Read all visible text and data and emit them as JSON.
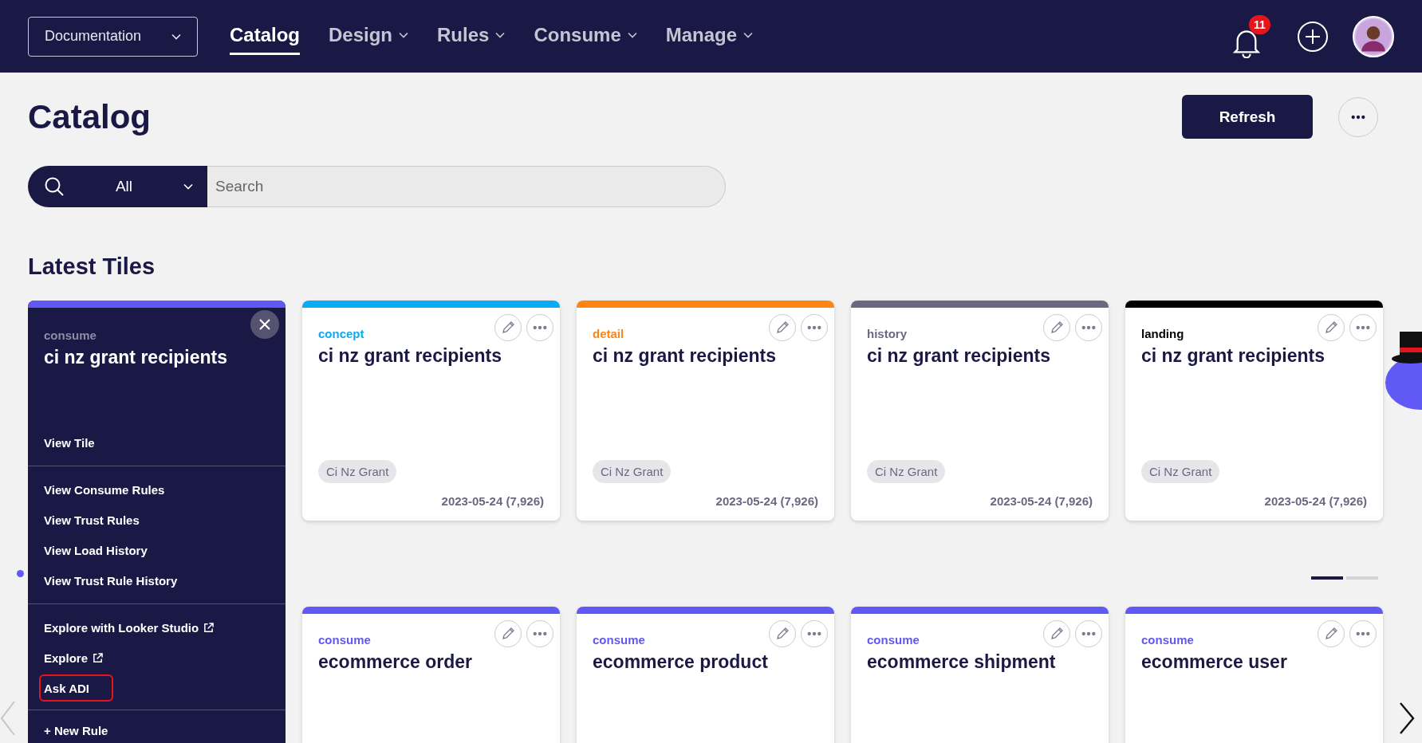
{
  "topbar": {
    "space_selector": "Documentation",
    "nav": [
      {
        "label": "Catalog",
        "selected": true,
        "has_menu": false
      },
      {
        "label": "Design",
        "selected": false,
        "has_menu": true
      },
      {
        "label": "Rules",
        "selected": false,
        "has_menu": true
      },
      {
        "label": "Consume",
        "selected": false,
        "has_menu": true
      },
      {
        "label": "Manage",
        "selected": false,
        "has_menu": true
      }
    ],
    "notification_count": "11"
  },
  "page": {
    "title": "Catalog",
    "refresh_button": "Refresh"
  },
  "search": {
    "scope": "All",
    "placeholder": "Search"
  },
  "section_title": "Latest Tiles",
  "tile_menu": {
    "category": "consume",
    "color": "#6159f5",
    "title": "ci nz grant recipients",
    "sections": [
      [
        {
          "label": "View Tile",
          "external": false,
          "highlighted": false
        }
      ],
      [
        {
          "label": "View Consume Rules",
          "external": false,
          "highlighted": false
        },
        {
          "label": "View Trust Rules",
          "external": false,
          "highlighted": false
        },
        {
          "label": "View Load History",
          "external": false,
          "highlighted": false
        },
        {
          "label": "View Trust Rule History",
          "external": false,
          "highlighted": false
        }
      ],
      [
        {
          "label": "Explore with Looker Studio",
          "external": true,
          "highlighted": false
        },
        {
          "label": "Explore",
          "external": true,
          "highlighted": false
        },
        {
          "label": "Ask ADI",
          "external": false,
          "highlighted": true
        }
      ],
      [
        {
          "label": "+ New Rule",
          "external": false,
          "highlighted": false
        }
      ]
    ]
  },
  "tiles": [
    {
      "category": "concept",
      "color": "#0aabf5",
      "title": "ci nz grant recipients",
      "tag": "Ci Nz Grant",
      "date": "2023-05-24 (7,926)"
    },
    {
      "category": "detail",
      "color": "#ff8412",
      "title": "ci nz grant recipients",
      "tag": "Ci Nz Grant",
      "date": "2023-05-24 (7,926)"
    },
    {
      "category": "history",
      "color": "#6b6882",
      "title": "ci nz grant recipients",
      "tag": "Ci Nz Grant",
      "date": "2023-05-24 (7,926)"
    },
    {
      "category": "landing",
      "color": "#000000",
      "title": "ci nz grant recipients",
      "tag": "Ci Nz Grant",
      "date": "2023-05-24 (7,926)"
    }
  ],
  "pages": [
    {
      "selected": true
    },
    {
      "selected": false
    }
  ],
  "tiles_row_2": [
    {
      "category": "consume",
      "color": "#6159f5",
      "title": "ecommerce order"
    },
    {
      "category": "consume",
      "color": "#6159f5",
      "title": "ecommerce product"
    },
    {
      "category": "consume",
      "color": "#6159f5",
      "title": "ecommerce shipment"
    },
    {
      "category": "consume",
      "color": "#6159f5",
      "title": "ecommerce user"
    }
  ]
}
